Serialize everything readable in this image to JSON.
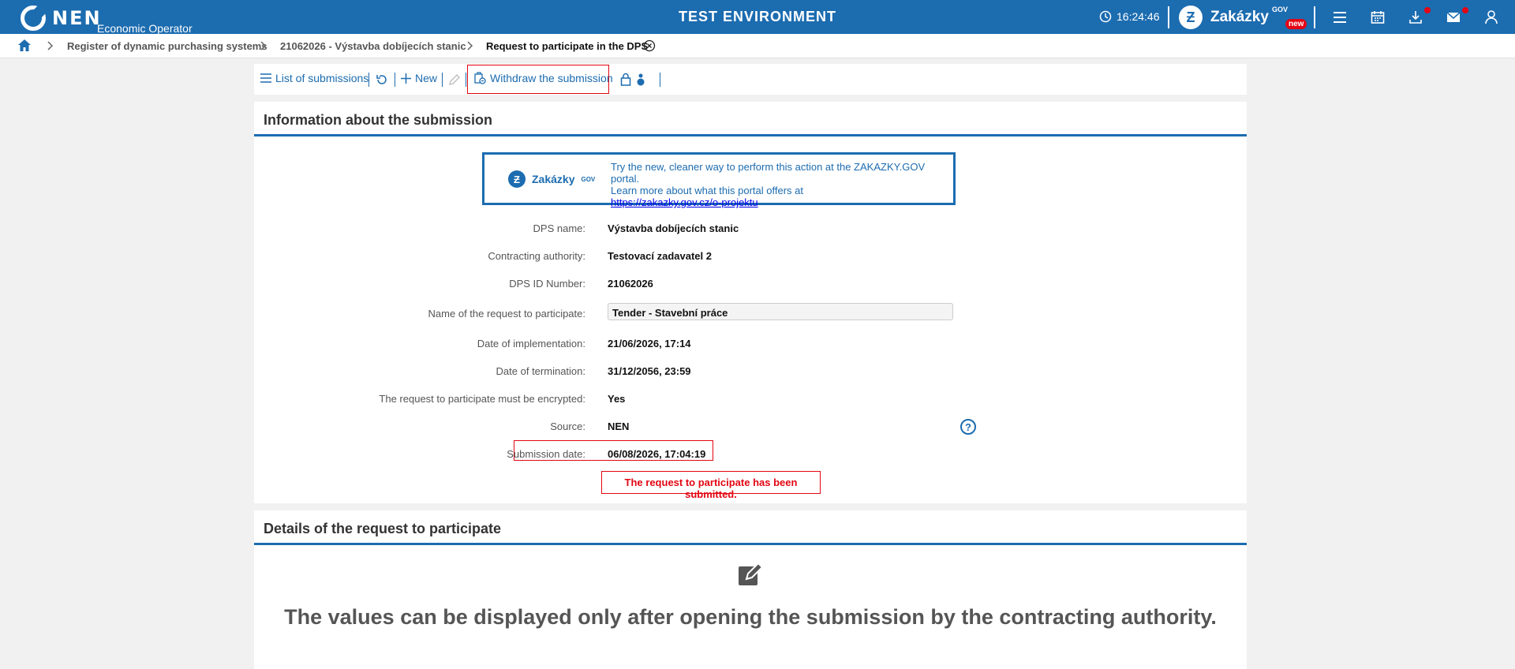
{
  "header": {
    "logo_text": "NEN",
    "logo_sub": "Economic Operator",
    "env_title": "TEST ENVIRONMENT",
    "clock": "16:24:46",
    "zakazky_label": "Zakázky",
    "zakazky_gov": "GOV",
    "zakazky_new": "new"
  },
  "breadcrumb": {
    "items": [
      "Register of dynamic purchasing systems",
      "21062026 - Výstavba dobíjecích stanic",
      "Request to participate in the DPS"
    ]
  },
  "toolbar": {
    "list_label": "List of submissions",
    "new_label": "New",
    "withdraw_label": "Withdraw the submission"
  },
  "info_panel": {
    "title": "Information about the submission",
    "banner": {
      "logo_label": "Zakázky",
      "logo_gov": "GOV",
      "line1": "Try the new, cleaner way to perform this action at the ZAKAZKY.GOV portal.",
      "line2": "Learn more about what this portal offers at",
      "link": "https://zakazky.gov.cz/o-projektu"
    },
    "fields": [
      {
        "label": "DPS name:",
        "value": "Výstavba dobíjecích stanic"
      },
      {
        "label": "Contracting authority:",
        "value": "Testovací zadavatel 2"
      },
      {
        "label": "DPS ID Number:",
        "value": "21062026"
      },
      {
        "label": "Name of the request to participate:",
        "value": "Tender - Stavební práce"
      },
      {
        "label": "Date of implementation:",
        "value": "21/06/2026, 17:14"
      },
      {
        "label": "Date of termination:",
        "value": "31/12/2056, 23:59"
      },
      {
        "label": "The request to participate must be encrypted:",
        "value": "Yes"
      },
      {
        "label": "Source:",
        "value": "NEN"
      },
      {
        "label": "Submission date:",
        "value": "06/08/2026, 17:04:19"
      }
    ],
    "help_symbol": "?",
    "status_message": "The request to participate has been submitted."
  },
  "details_panel": {
    "title": "Details of the request to participate",
    "empty_message": "The values can be displayed only after opening the submission by the contracting authority."
  }
}
